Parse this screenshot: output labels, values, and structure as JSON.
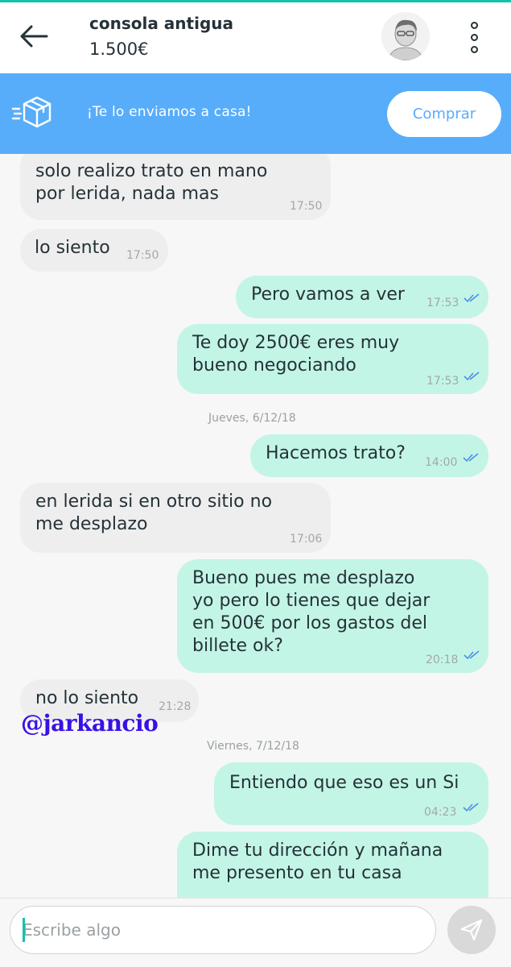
{
  "header": {
    "title": "consola antigua",
    "price": "1.500€",
    "back_icon": "arrow-left-icon",
    "menu_icon": "more-vertical-icon"
  },
  "banner": {
    "text": "¡Te lo enviamos a casa!",
    "button_label": "Comprar",
    "icon": "box-delivery-icon",
    "color": "#58adfb"
  },
  "messages": [
    {
      "dir": "in",
      "lines": [
        "solo realizo trato en mano",
        "por lerida, nada mas"
      ],
      "time": "17:50"
    },
    {
      "dir": "in",
      "lines": [
        "lo siento"
      ],
      "time": "17:50"
    },
    {
      "dir": "out",
      "lines": [
        "Pero vamos a ver"
      ],
      "time": "17:53",
      "read": true
    },
    {
      "dir": "out",
      "lines": [
        "Te doy 2500€ eres muy",
        "bueno negociando"
      ],
      "time": "17:53",
      "read": true
    },
    {
      "dir": "out",
      "lines": [
        "Hacemos trato?"
      ],
      "time": "14:00",
      "read": true
    },
    {
      "dir": "in",
      "lines": [
        "en lerida si en otro sitio no",
        "me desplazo"
      ],
      "time": "17:06"
    },
    {
      "dir": "out",
      "lines": [
        "Bueno pues me desplazo",
        "yo pero lo tienes que dejar",
        "en 500€ por los gastos del",
        "billete ok?"
      ],
      "time": "20:18",
      "read": true
    },
    {
      "dir": "in",
      "lines": [
        "no lo siento"
      ],
      "time": "21:28"
    },
    {
      "dir": "out",
      "lines": [
        "Entiendo que eso es un Si"
      ],
      "time": "04:23",
      "read": true
    },
    {
      "dir": "out",
      "lines": [
        "Dime tu dirección y mañana",
        "me presento en tu casa"
      ],
      "time": "",
      "read": false
    }
  ],
  "separators": [
    "Jueves, 6/12/18",
    "Viernes, 7/12/18"
  ],
  "watermark": "@jarkancio",
  "composer": {
    "placeholder": "Escribe algo",
    "send_icon": "send-icon"
  },
  "colors": {
    "accent": "#13c1ac",
    "outgoing_bubble": "#c3f5e6",
    "incoming_bubble": "#eeeeee",
    "read_ticks": "#4a90e2"
  }
}
